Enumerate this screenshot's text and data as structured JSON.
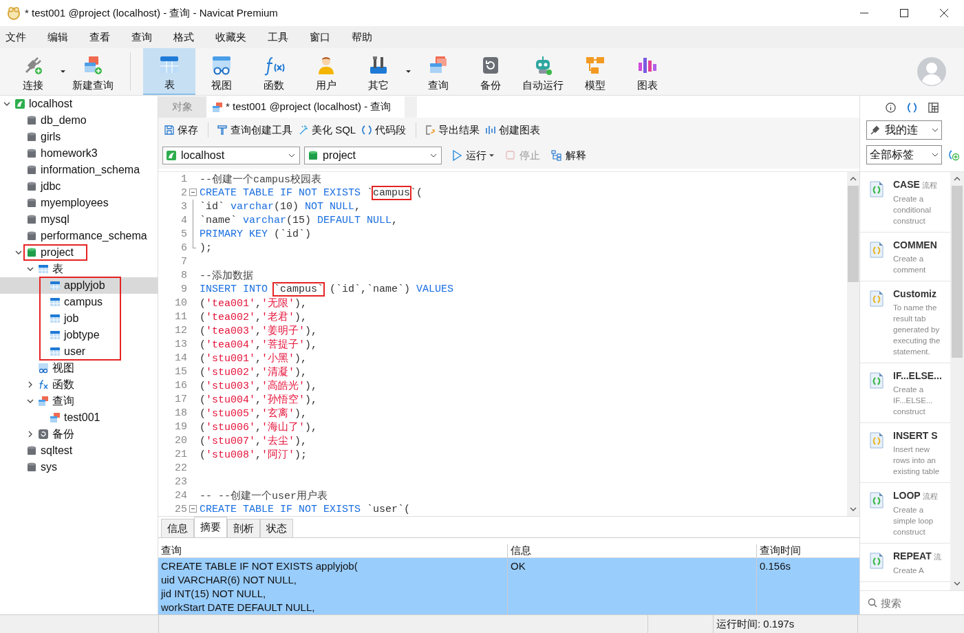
{
  "window": {
    "title": "* test001 @project (localhost) - 查询 - Navicat Premium"
  },
  "menu": [
    "文件",
    "编辑",
    "查看",
    "查询",
    "格式",
    "收藏夹",
    "工具",
    "窗口",
    "帮助"
  ],
  "toolbar": {
    "groups": [
      [
        {
          "label": "连接",
          "kind": "connect",
          "selected": false,
          "dropdown": true
        },
        {
          "label": "新建查询",
          "kind": "new-query",
          "selected": false,
          "dropdown": false
        }
      ],
      [
        {
          "label": "表",
          "kind": "table",
          "selected": true,
          "dropdown": false
        },
        {
          "label": "视图",
          "kind": "view",
          "selected": false,
          "dropdown": false
        },
        {
          "label": "函数",
          "kind": "function",
          "selected": false,
          "dropdown": false
        },
        {
          "label": "用户",
          "kind": "user",
          "selected": false,
          "dropdown": false
        },
        {
          "label": "其它",
          "kind": "other",
          "selected": false,
          "dropdown": true
        },
        {
          "label": "查询",
          "kind": "query",
          "selected": false,
          "dropdown": false
        },
        {
          "label": "备份",
          "kind": "backup",
          "selected": false,
          "dropdown": false
        },
        {
          "label": "自动运行",
          "kind": "autorun",
          "selected": false,
          "dropdown": false
        },
        {
          "label": "模型",
          "kind": "model",
          "selected": false,
          "dropdown": false
        },
        {
          "label": "图表",
          "kind": "chart",
          "selected": false,
          "dropdown": false
        }
      ]
    ]
  },
  "tree": [
    {
      "label": "localhost",
      "kind": "server",
      "expanded": true,
      "selected": false,
      "children": [
        {
          "label": "db_demo",
          "kind": "db",
          "selected": false
        },
        {
          "label": "girls",
          "kind": "db",
          "selected": false
        },
        {
          "label": "homework3",
          "kind": "db",
          "selected": false
        },
        {
          "label": "information_schema",
          "kind": "db",
          "selected": false
        },
        {
          "label": "jdbc",
          "kind": "db",
          "selected": false
        },
        {
          "label": "myemployees",
          "kind": "db",
          "selected": false
        },
        {
          "label": "mysql",
          "kind": "db",
          "selected": false
        },
        {
          "label": "performance_schema",
          "kind": "db",
          "selected": false
        },
        {
          "label": "project",
          "kind": "db-open",
          "expanded": true,
          "selected": false,
          "boxed": true,
          "children": [
            {
              "label": "表",
              "kind": "table",
              "expanded": true,
              "selected": false,
              "children_boxed": true,
              "children": [
                {
                  "label": "applyjob",
                  "kind": "table",
                  "selected": true
                },
                {
                  "label": "campus",
                  "kind": "table",
                  "selected": false
                },
                {
                  "label": "job",
                  "kind": "table",
                  "selected": false
                },
                {
                  "label": "jobtype",
                  "kind": "table",
                  "selected": false
                },
                {
                  "label": "user",
                  "kind": "table",
                  "selected": false
                }
              ]
            },
            {
              "label": "视图",
              "kind": "view",
              "selected": false
            },
            {
              "label": "函数",
              "kind": "function",
              "expanded": false,
              "selected": false
            },
            {
              "label": "查询",
              "kind": "query",
              "expanded": true,
              "selected": false,
              "children": [
                {
                  "label": "test001",
                  "kind": "query",
                  "selected": false
                }
              ]
            },
            {
              "label": "备份",
              "kind": "backup",
              "expanded": false,
              "selected": false
            }
          ]
        },
        {
          "label": "sqltest",
          "kind": "db",
          "selected": false
        },
        {
          "label": "sys",
          "kind": "db",
          "selected": false
        }
      ]
    }
  ],
  "tabs": [
    {
      "label": "对象",
      "kind": "plain",
      "selected": false
    },
    {
      "label": "* test001 @project (localhost) - 查询",
      "kind": "query",
      "selected": true
    }
  ],
  "editor_toolbar": {
    "groups": [
      [
        {
          "label": "保存",
          "kind": "save"
        }
      ],
      [
        {
          "label": "查询创建工具",
          "kind": "builder"
        },
        {
          "label": "美化 SQL",
          "kind": "beautify"
        },
        {
          "label": "代码段",
          "kind": "snippet"
        }
      ],
      [
        {
          "label": "导出结果",
          "kind": "export"
        },
        {
          "label": "创建图表",
          "kind": "chart"
        }
      ]
    ]
  },
  "selectors": {
    "connection": "localhost",
    "database": "project"
  },
  "run_controls": [
    {
      "label": "运行",
      "kind": "run",
      "disabled": false,
      "dropdown": true
    },
    {
      "label": "停止",
      "kind": "stop",
      "disabled": true,
      "dropdown": false
    },
    {
      "label": "解释",
      "kind": "explain",
      "disabled": false,
      "dropdown": false
    }
  ],
  "editor": {
    "lines": [
      {
        "n": "1",
        "kind": "plain",
        "tokens": [
          {
            "t": "--创建一个campus校园表",
            "kind": "comment"
          }
        ]
      },
      {
        "n": "2",
        "kind": "fold-start",
        "tokens": [
          {
            "t": "CREATE TABLE IF NOT EXISTS",
            "kind": "keyword"
          },
          {
            "t": " `",
            "kind": "plain"
          },
          {
            "t": "campus",
            "kind": "plain",
            "boxed": true
          },
          {
            "t": "`(",
            "kind": "plain"
          }
        ]
      },
      {
        "n": "3",
        "kind": "fold-mid",
        "tokens": [
          {
            "t": "`id` ",
            "kind": "plain"
          },
          {
            "t": "varchar",
            "kind": "keyword"
          },
          {
            "t": "(",
            "kind": "plain"
          },
          {
            "t": "10",
            "kind": "number"
          },
          {
            "t": ") ",
            "kind": "plain"
          },
          {
            "t": "NOT NULL",
            "kind": "keyword"
          },
          {
            "t": ",",
            "kind": "plain"
          }
        ]
      },
      {
        "n": "4",
        "kind": "fold-mid",
        "tokens": [
          {
            "t": "`name` ",
            "kind": "plain"
          },
          {
            "t": "varchar",
            "kind": "keyword"
          },
          {
            "t": "(",
            "kind": "plain"
          },
          {
            "t": "15",
            "kind": "number"
          },
          {
            "t": ") ",
            "kind": "plain"
          },
          {
            "t": "DEFAULT NULL",
            "kind": "keyword"
          },
          {
            "t": ",",
            "kind": "plain"
          }
        ]
      },
      {
        "n": "5",
        "kind": "fold-mid",
        "tokens": [
          {
            "t": "PRIMARY KEY",
            "kind": "keyword"
          },
          {
            "t": " (`id`)",
            "kind": "plain"
          }
        ]
      },
      {
        "n": "6",
        "kind": "fold-end",
        "tokens": [
          {
            "t": ");",
            "kind": "plain"
          }
        ]
      },
      {
        "n": "7",
        "kind": "plain"
      },
      {
        "n": "8",
        "kind": "plain",
        "tokens": [
          {
            "t": "--添加数据",
            "kind": "comment"
          }
        ]
      },
      {
        "n": "9",
        "kind": "plain",
        "tokens": [
          {
            "t": "INSERT INTO ",
            "kind": "keyword"
          },
          {
            "t": "`campus`",
            "kind": "plain",
            "boxed": true
          },
          {
            "t": " (`id`,`name`) ",
            "kind": "plain"
          },
          {
            "t": "VALUES",
            "kind": "keyword"
          }
        ]
      },
      {
        "n": "10",
        "kind": "plain",
        "tokens": [
          {
            "t": "(",
            "kind": "plain"
          },
          {
            "t": "'tea001'",
            "kind": "string"
          },
          {
            "t": ",",
            "kind": "plain"
          },
          {
            "t": "'无限'",
            "kind": "string"
          },
          {
            "t": "),",
            "kind": "plain"
          }
        ]
      },
      {
        "n": "11",
        "kind": "plain",
        "tokens": [
          {
            "t": "(",
            "kind": "plain"
          },
          {
            "t": "'tea002'",
            "kind": "string"
          },
          {
            "t": ",",
            "kind": "plain"
          },
          {
            "t": "'老君'",
            "kind": "string"
          },
          {
            "t": "),",
            "kind": "plain"
          }
        ]
      },
      {
        "n": "12",
        "kind": "plain",
        "tokens": [
          {
            "t": "(",
            "kind": "plain"
          },
          {
            "t": "'tea003'",
            "kind": "string"
          },
          {
            "t": ",",
            "kind": "plain"
          },
          {
            "t": "'姜明子'",
            "kind": "string"
          },
          {
            "t": "),",
            "kind": "plain"
          }
        ]
      },
      {
        "n": "13",
        "kind": "plain",
        "tokens": [
          {
            "t": "(",
            "kind": "plain"
          },
          {
            "t": "'tea004'",
            "kind": "string"
          },
          {
            "t": ",",
            "kind": "plain"
          },
          {
            "t": "'菩提子'",
            "kind": "string"
          },
          {
            "t": "),",
            "kind": "plain"
          }
        ]
      },
      {
        "n": "14",
        "kind": "plain",
        "tokens": [
          {
            "t": "(",
            "kind": "plain"
          },
          {
            "t": "'stu001'",
            "kind": "string"
          },
          {
            "t": ",",
            "kind": "plain"
          },
          {
            "t": "'小黑'",
            "kind": "string"
          },
          {
            "t": "),",
            "kind": "plain"
          }
        ]
      },
      {
        "n": "15",
        "kind": "plain",
        "tokens": [
          {
            "t": "(",
            "kind": "plain"
          },
          {
            "t": "'stu002'",
            "kind": "string"
          },
          {
            "t": ",",
            "kind": "plain"
          },
          {
            "t": "'清凝'",
            "kind": "string"
          },
          {
            "t": "),",
            "kind": "plain"
          }
        ]
      },
      {
        "n": "16",
        "kind": "plain",
        "tokens": [
          {
            "t": "(",
            "kind": "plain"
          },
          {
            "t": "'stu003'",
            "kind": "string"
          },
          {
            "t": ",",
            "kind": "plain"
          },
          {
            "t": "'高皓光'",
            "kind": "string"
          },
          {
            "t": "),",
            "kind": "plain"
          }
        ]
      },
      {
        "n": "17",
        "kind": "plain",
        "tokens": [
          {
            "t": "(",
            "kind": "plain"
          },
          {
            "t": "'stu004'",
            "kind": "string"
          },
          {
            "t": ",",
            "kind": "plain"
          },
          {
            "t": "'孙悟空'",
            "kind": "string"
          },
          {
            "t": "),",
            "kind": "plain"
          }
        ]
      },
      {
        "n": "18",
        "kind": "plain",
        "tokens": [
          {
            "t": "(",
            "kind": "plain"
          },
          {
            "t": "'stu005'",
            "kind": "string"
          },
          {
            "t": ",",
            "kind": "plain"
          },
          {
            "t": "'玄离'",
            "kind": "string"
          },
          {
            "t": "),",
            "kind": "plain"
          }
        ]
      },
      {
        "n": "19",
        "kind": "plain",
        "tokens": [
          {
            "t": "(",
            "kind": "plain"
          },
          {
            "t": "'stu006'",
            "kind": "string"
          },
          {
            "t": ",",
            "kind": "plain"
          },
          {
            "t": "'海山了'",
            "kind": "string"
          },
          {
            "t": "),",
            "kind": "plain"
          }
        ]
      },
      {
        "n": "20",
        "kind": "plain",
        "tokens": [
          {
            "t": "(",
            "kind": "plain"
          },
          {
            "t": "'stu007'",
            "kind": "string"
          },
          {
            "t": ",",
            "kind": "plain"
          },
          {
            "t": "'去尘'",
            "kind": "string"
          },
          {
            "t": "),",
            "kind": "plain"
          }
        ]
      },
      {
        "n": "21",
        "kind": "plain",
        "tokens": [
          {
            "t": "(",
            "kind": "plain"
          },
          {
            "t": "'stu008'",
            "kind": "string"
          },
          {
            "t": ",",
            "kind": "plain"
          },
          {
            "t": "'阿汀'",
            "kind": "string"
          },
          {
            "t": ");",
            "kind": "plain"
          }
        ]
      },
      {
        "n": "22",
        "kind": "plain"
      },
      {
        "n": "23",
        "kind": "plain"
      },
      {
        "n": "24",
        "kind": "plain",
        "tokens": [
          {
            "t": "-- --创建一个user用户表",
            "kind": "comment"
          }
        ]
      },
      {
        "n": "25",
        "kind": "fold-start",
        "tokens": [
          {
            "t": "CREATE TABLE IF NOT EXISTS",
            "kind": "keyword"
          },
          {
            "t": " `user`(",
            "kind": "plain"
          }
        ]
      }
    ]
  },
  "results": {
    "tabs": [
      {
        "label": "信息",
        "selected": false
      },
      {
        "label": "摘要",
        "selected": true
      },
      {
        "label": "剖析",
        "selected": false
      },
      {
        "label": "状态",
        "selected": false
      }
    ],
    "columns": [
      "查询",
      "信息",
      "查询时间"
    ],
    "rows": [
      {
        "selected": true,
        "cells": [
          "CREATE TABLE IF NOT EXISTS applyjob(\nuid VARCHAR(6) NOT NULL,\njid INT(15) NOT NULL,\nworkStart DATE DEFAULT NULL,",
          "OK",
          "0.156s"
        ]
      }
    ]
  },
  "status_bar": {
    "text": "运行时间: 0.197s"
  },
  "side_panel": {
    "tools": [
      {
        "kind": "info",
        "selected": false
      },
      {
        "kind": "snippets",
        "selected": true
      },
      {
        "kind": "grid",
        "selected": false
      }
    ],
    "connection_filter": "我的连",
    "tag_filter": "全部标签",
    "snippets": [
      {
        "title": "CASE",
        "tag": "流程",
        "desc": "Create a conditional construct",
        "color": "#3cb84a"
      },
      {
        "title": "COMMEN",
        "desc": "Create a comment",
        "color": "#e8b830"
      },
      {
        "title": "Customiz",
        "desc": "To name the result tab generated by executing the statement.",
        "color": "#e8b830"
      },
      {
        "title": "IF...ELSE...",
        "desc": "Create a IF...ELSE... construct",
        "color": "#3cb84a"
      },
      {
        "title": "INSERT S",
        "desc": "Insert new rows into an existing table",
        "color": "#e8b830"
      },
      {
        "title": "LOOP",
        "tag": "流程",
        "desc": "Create a simple loop construct",
        "color": "#3cb84a"
      },
      {
        "title": "REPEAT",
        "tag": "流",
        "desc": "Create A",
        "color": "#3cb84a"
      }
    ],
    "search": {
      "placeholder": "搜索"
    }
  }
}
